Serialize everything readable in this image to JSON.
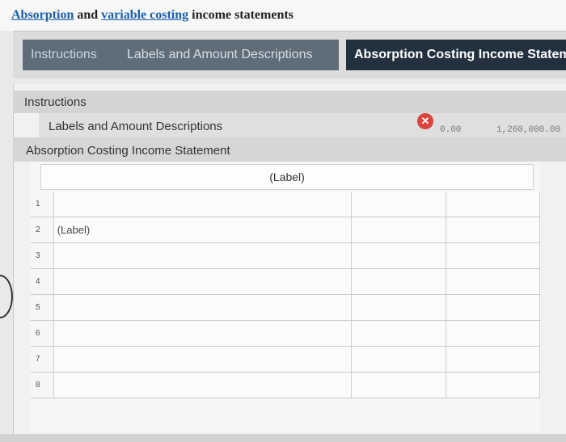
{
  "title": {
    "link1": "Absorption",
    "text1": " and ",
    "link2": "variable costing",
    "text2": " income statements"
  },
  "tabs": [
    {
      "label": "Instructions"
    },
    {
      "label": "Labels and Amount Descriptions"
    },
    {
      "label": "Absorption Costing Income Statement"
    }
  ],
  "accordions": {
    "instructions": "Instructions",
    "labels": "Labels and Amount Descriptions",
    "statement": "Absorption Costing Income Statement"
  },
  "popup_fragments": {
    "left": "0.00",
    "right": "1,260,000.00"
  },
  "sheet": {
    "header_label": "(Label)",
    "rows": [
      {
        "num": "1",
        "label": ""
      },
      {
        "num": "2",
        "label": "(Label)"
      },
      {
        "num": "3",
        "label": ""
      },
      {
        "num": "4",
        "label": ""
      },
      {
        "num": "5",
        "label": ""
      },
      {
        "num": "6",
        "label": ""
      },
      {
        "num": "7",
        "label": ""
      },
      {
        "num": "8",
        "label": ""
      }
    ]
  },
  "colors": {
    "active_tab": "#22313d",
    "inactive_tab": "#5f6d78",
    "close_button": "#d9443b",
    "link": "#1a5fa8"
  }
}
